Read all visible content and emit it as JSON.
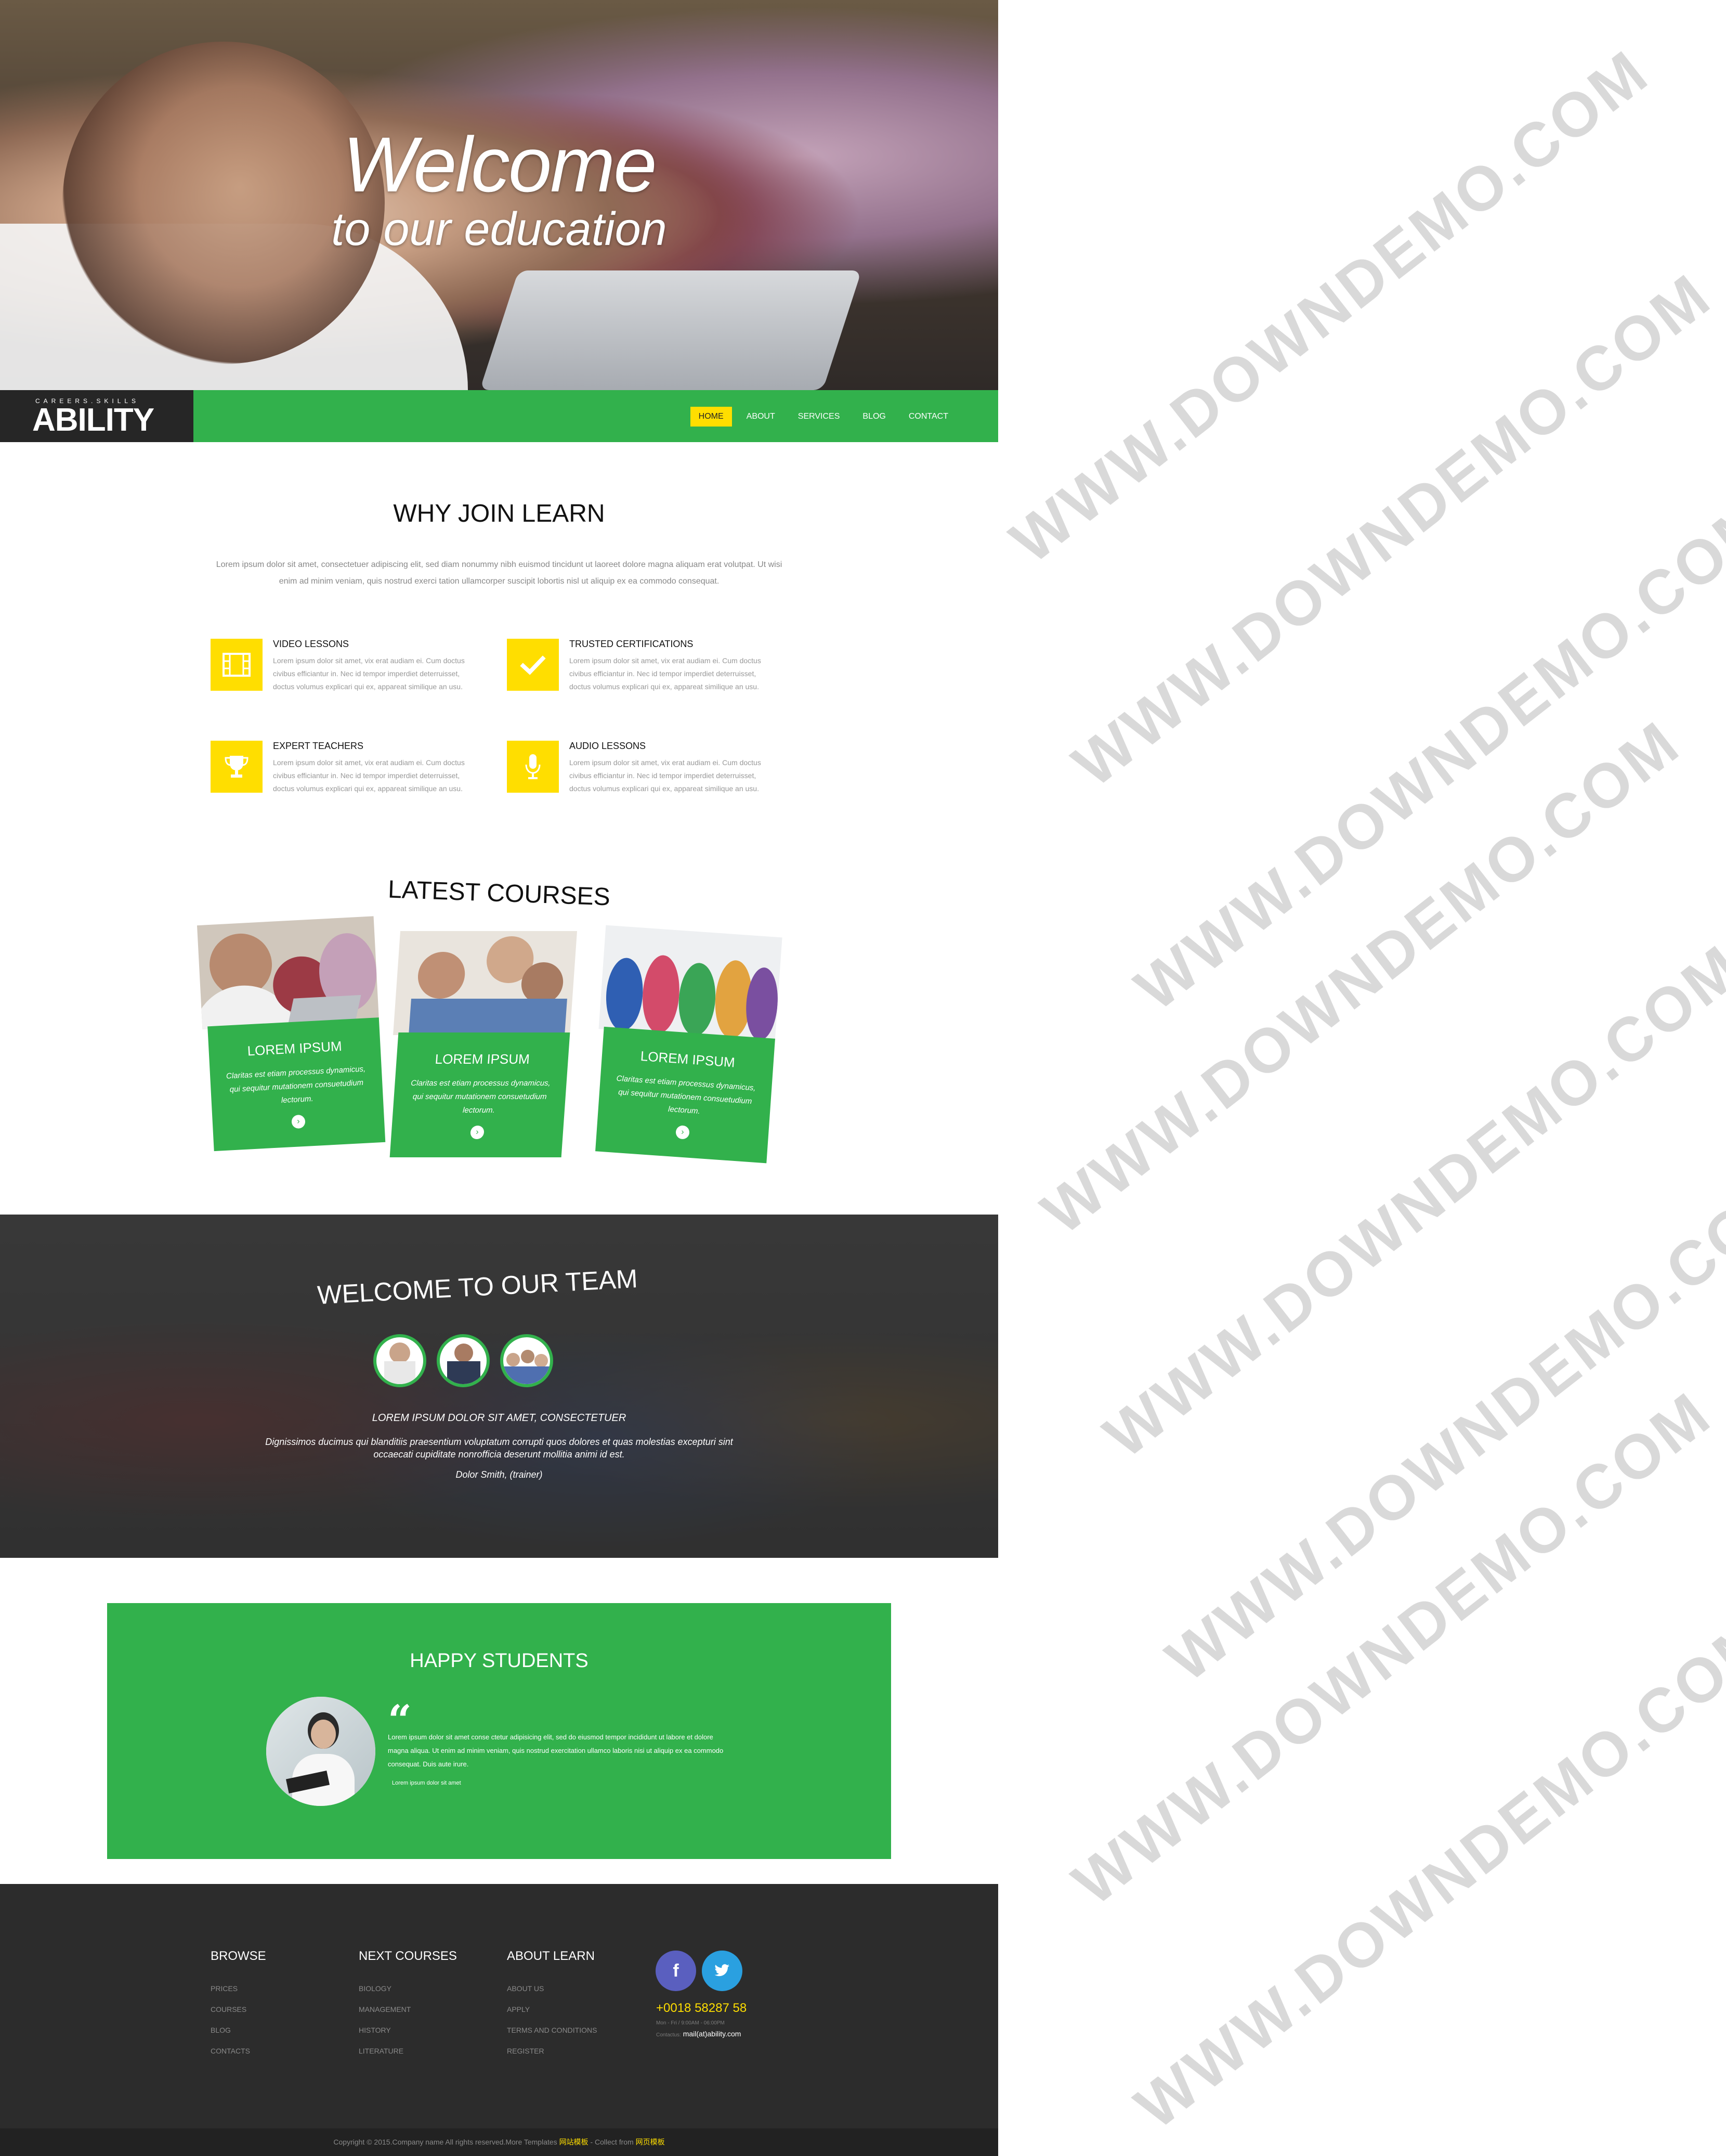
{
  "hero": {
    "title": "Welcome",
    "subtitle": "to our education"
  },
  "brand": {
    "tagline": "CAREERS.SKILLS",
    "name": "ABILITY"
  },
  "nav": {
    "items": [
      "HOME",
      "ABOUT",
      "SERVICES",
      "BLOG",
      "CONTACT"
    ],
    "active": "HOME"
  },
  "why": {
    "title": "WHY JOIN LEARN",
    "lead": "Lorem ipsum dolor sit amet, consectetuer adipiscing elit, sed diam nonummy nibh euismod tincidunt ut laoreet dolore magna aliquam erat volutpat. Ut wisi enim ad minim veniam, quis nostrud exerci tation ullamcorper suscipit lobortis nisl ut aliquip ex ea commodo consequat.",
    "features": [
      {
        "title": "VIDEO LESSONS",
        "icon": "film-icon",
        "text": "Lorem ipsum dolor sit amet, vix erat audiam ei. Cum doctus civibus efficiantur in. Nec id tempor imperdiet deterruisset, doctus volumus explicari qui ex, appareat similique an usu."
      },
      {
        "title": "TRUSTED CERTIFICATIONS",
        "icon": "check-icon",
        "text": "Lorem ipsum dolor sit amet, vix erat audiam ei. Cum doctus civibus efficiantur in. Nec id tempor imperdiet deterruisset, doctus volumus explicari qui ex, appareat similique an usu."
      },
      {
        "title": "EXPERT TEACHERS",
        "icon": "trophy-icon",
        "text": "Lorem ipsum dolor sit amet, vix erat audiam ei. Cum doctus civibus efficiantur in. Nec id tempor imperdiet deterruisset, doctus volumus explicari qui ex, appareat similique an usu."
      },
      {
        "title": "AUDIO LESSONS",
        "icon": "microphone-icon",
        "text": "Lorem ipsum dolor sit amet, vix erat audiam ei. Cum doctus civibus efficiantur in. Nec id tempor imperdiet deterruisset, doctus volumus explicari qui ex, appareat similique an usu."
      }
    ]
  },
  "courses": {
    "title": "LATEST COURSES",
    "items": [
      {
        "title": "LOREM IPSUM",
        "text": "Claritas est etiam processus dynamicus, qui sequitur mutationem consuetudium lectorum."
      },
      {
        "title": "LOREM IPSUM",
        "text": "Claritas est etiam processus dynamicus, qui sequitur mutationem consuetudium lectorum."
      },
      {
        "title": "LOREM IPSUM",
        "text": "Claritas est etiam processus dynamicus, qui sequitur mutationem consuetudium lectorum."
      }
    ]
  },
  "team": {
    "title": "WELCOME TO OUR TEAM",
    "quote_head": "LOREM IPSUM DOLOR SIT AMET, CONSECTETUER",
    "quote": "Dignissimos ducimus qui blanditiis praesentium voluptatum corrupti quos dolores et quas molestias excepturi sint occaecati cupiditate nonrofficia deserunt mollitia animi id est.",
    "author": "Dolor Smith, (trainer)"
  },
  "happy": {
    "title": "HAPPY STUDENTS",
    "text": "Lorem ipsum dolor sit amet conse ctetur adipisicing elit, sed do eiusmod tempor incididunt ut labore et dolore magna aliqua. Ut enim ad minim veniam, quis nostrud exercitation ullamco laboris nisi ut aliquip ex ea commodo consequat. Duis aute irure.",
    "author": "Lorem ipsum dolor sit amet"
  },
  "footer": {
    "columns": [
      {
        "head": "BROWSE",
        "links": [
          "PRICES",
          "COURSES",
          "BLOG",
          "CONTACTS"
        ]
      },
      {
        "head": "NEXT COURSES",
        "links": [
          "BIOLOGY",
          "MANAGEMENT",
          "HISTORY",
          "LITERATURE"
        ]
      },
      {
        "head": "ABOUT LEARN",
        "links": [
          "ABOUT US",
          "APPLY",
          "TERMS AND CONDITIONS",
          "REGISTER"
        ]
      }
    ],
    "social": {
      "facebook": "f",
      "twitter": "t"
    },
    "phone": "+0018 58287 58",
    "hours": "Mon - Fri / 9:00AM - 06:00PM",
    "email_label": "Contactus:",
    "email": "mail(at)ability.com",
    "copyright_prefix": "Copyright © 2015.Company name All rights reserved.More Templates",
    "copyright_hl1": "网站模板",
    "copyright_mid": "- Collect from",
    "copyright_hl2": "网页模板"
  },
  "watermark": "WWW.DOWNDEMO.COM",
  "colors": {
    "green": "#32b14c",
    "yellow": "#ffde00",
    "dark": "#262626",
    "footer": "#2c2c2c"
  }
}
